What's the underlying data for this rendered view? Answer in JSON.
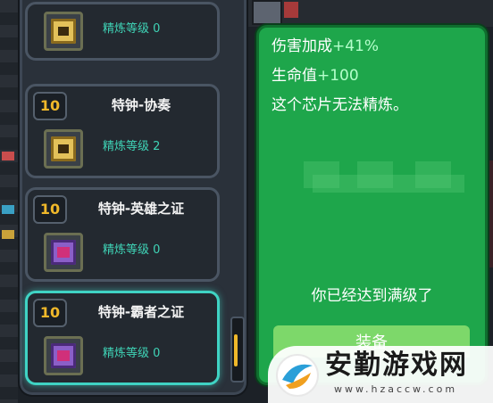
{
  "chip_list": {
    "cards": [
      {
        "level": "",
        "name": "",
        "refine_label": "精炼等级",
        "refine_value": "0",
        "icon": "gold-chip-icon"
      },
      {
        "level": "10",
        "name": "特钟-协奏",
        "refine_label": "精炼等级",
        "refine_value": "2",
        "icon": "gold-chip-icon"
      },
      {
        "level": "10",
        "name": "特钟-英雄之证",
        "refine_label": "精炼等级",
        "refine_value": "0",
        "icon": "purple-chip-icon"
      },
      {
        "level": "10",
        "name": "特钟-霸者之证",
        "refine_label": "精炼等级",
        "refine_value": "0",
        "icon": "purple-chip-icon",
        "selected": true
      }
    ]
  },
  "info_panel": {
    "line1_label": "伤害加成",
    "line1_value": "+41%",
    "line2_label": "生命值",
    "line2_value": "+100",
    "line3": "这个芯片无法精炼。",
    "maxed_text": "你已经达到满级了",
    "equip_label": "装备"
  },
  "watermark": {
    "title": "安勤游戏网",
    "url": "www.hzaccw.com"
  },
  "colors": {
    "accent_teal": "#3fd3c4",
    "panel_green": "#1ea64b",
    "level_gold": "#f0b82a"
  }
}
